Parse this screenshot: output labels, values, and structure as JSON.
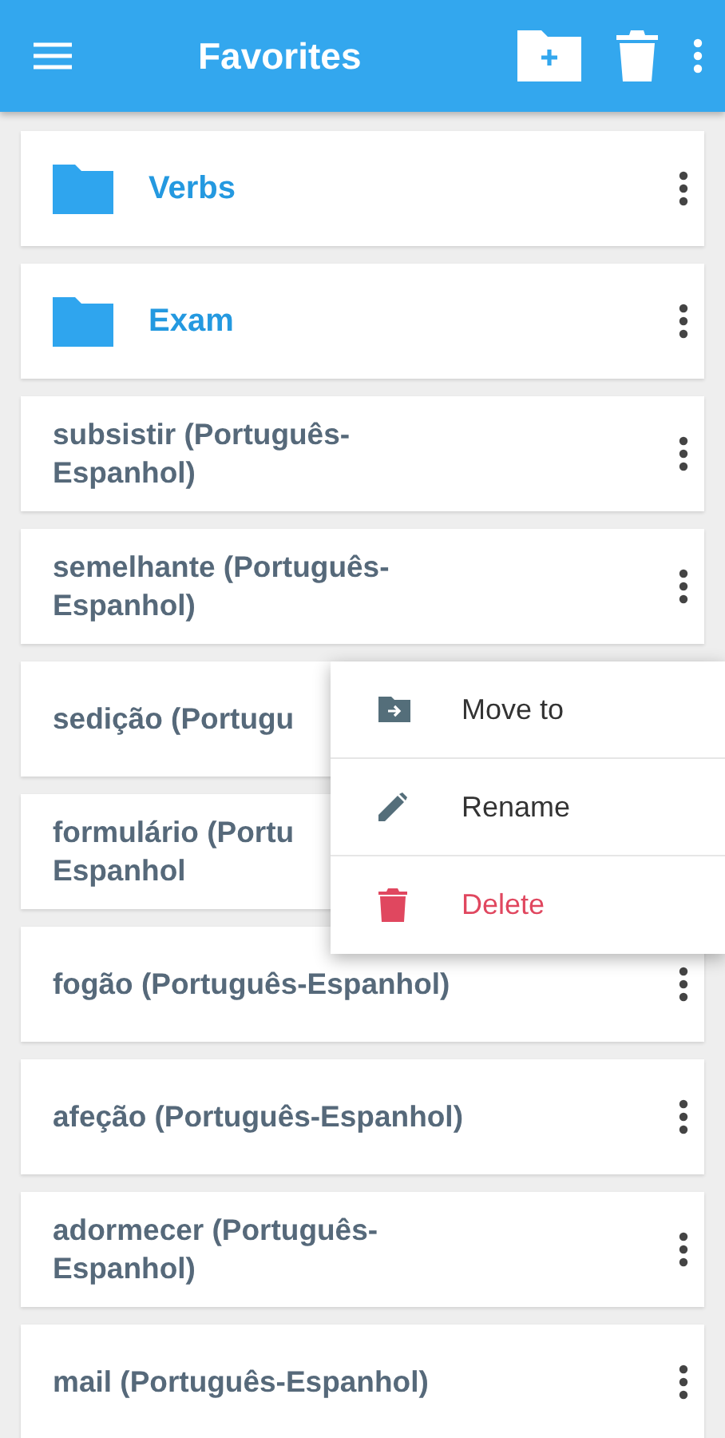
{
  "app_bar": {
    "title": "Favorites"
  },
  "items": [
    {
      "kind": "folder",
      "label": "Verbs"
    },
    {
      "kind": "folder",
      "label": "Exam"
    },
    {
      "kind": "word",
      "label": "subsistir (Português-\nEspanhol)"
    },
    {
      "kind": "word",
      "label": "semelhante (Português-\nEspanhol)"
    },
    {
      "kind": "word",
      "label": "sedição (Portugu",
      "menu": [
        {
          "kind": "move",
          "label": "Move to"
        },
        {
          "kind": "rename",
          "label": "Rename"
        },
        {
          "kind": "delete",
          "label": "Delete"
        }
      ]
    },
    {
      "kind": "word",
      "label": "formulário (Portu\nEspanhol"
    },
    {
      "kind": "word",
      "label": "fogão (Português-Espanhol)"
    },
    {
      "kind": "word",
      "label": "afeção (Português-Espanhol)"
    },
    {
      "kind": "word",
      "label": "adormecer (Português-\nEspanhol)"
    },
    {
      "kind": "word",
      "label": "mail (Português-Espanhol)"
    }
  ]
}
